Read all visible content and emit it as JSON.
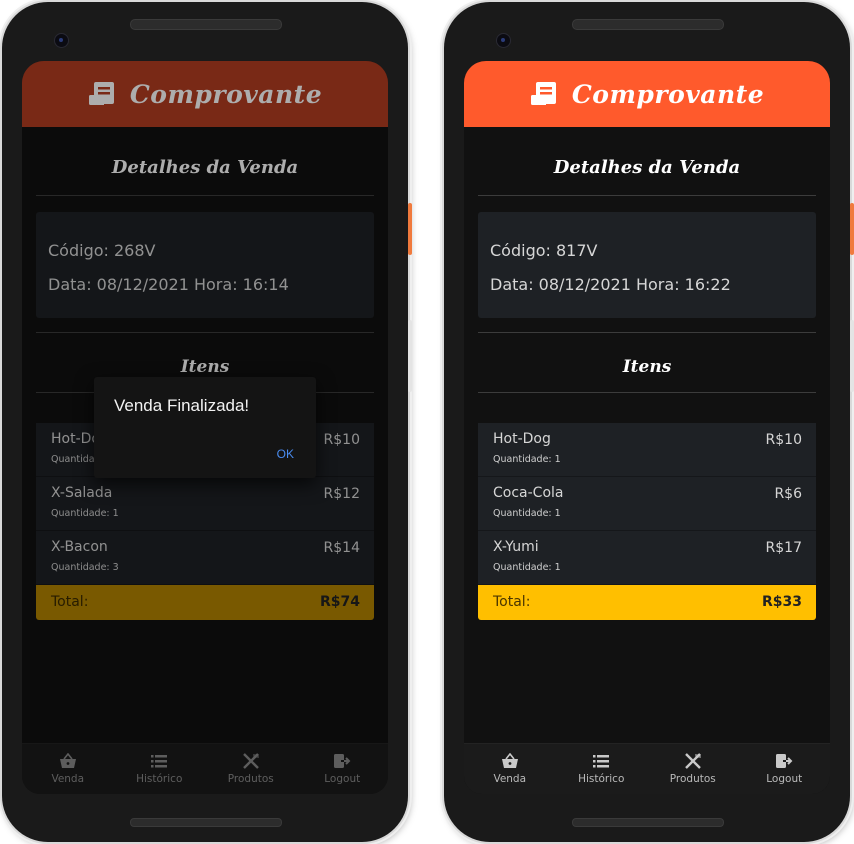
{
  "colors": {
    "left_header": "#b33d21",
    "right_header": "#ff5a2c",
    "left_total": "#b38400",
    "right_total": "#ffbf00",
    "dialog_ok": "#4a8cf0"
  },
  "screens": [
    {
      "header": {
        "title": "Comprovante",
        "icon": "receipt-icon"
      },
      "details_title": "Detalhes da Venda",
      "codigo": "Código: 268V",
      "data_hora": "Data: 08/12/2021 Hora: 16:14",
      "items_title": "Itens",
      "items": [
        {
          "name": "Hot-Dog",
          "qty": "Quantidade: 1",
          "price": "R$10"
        },
        {
          "name": "X-Salada",
          "qty": "Quantidade: 1",
          "price": "R$12"
        },
        {
          "name": "X-Bacon",
          "qty": "Quantidade: 3",
          "price": "R$14"
        }
      ],
      "total_label": "Total:",
      "total_value": "R$74",
      "dialog": {
        "title": "Venda Finalizada!",
        "ok": "OK"
      },
      "nav": [
        {
          "label": "Venda",
          "icon": "basket-icon"
        },
        {
          "label": "Histórico",
          "icon": "list-icon"
        },
        {
          "label": "Produtos",
          "icon": "fork-knife-icon"
        },
        {
          "label": "Logout",
          "icon": "logout-icon"
        }
      ]
    },
    {
      "header": {
        "title": "Comprovante",
        "icon": "receipt-icon"
      },
      "details_title": "Detalhes da Venda",
      "codigo": "Código: 817V",
      "data_hora": "Data: 08/12/2021 Hora: 16:22",
      "items_title": "Itens",
      "items": [
        {
          "name": "Hot-Dog",
          "qty": "Quantidade: 1",
          "price": "R$10"
        },
        {
          "name": "Coca-Cola",
          "qty": "Quantidade: 1",
          "price": "R$6"
        },
        {
          "name": "X-Yumi",
          "qty": "Quantidade: 1",
          "price": "R$17"
        }
      ],
      "total_label": "Total:",
      "total_value": "R$33",
      "nav": [
        {
          "label": "Venda",
          "icon": "basket-icon"
        },
        {
          "label": "Histórico",
          "icon": "list-icon"
        },
        {
          "label": "Produtos",
          "icon": "fork-knife-icon"
        },
        {
          "label": "Logout",
          "icon": "logout-icon"
        }
      ]
    }
  ]
}
